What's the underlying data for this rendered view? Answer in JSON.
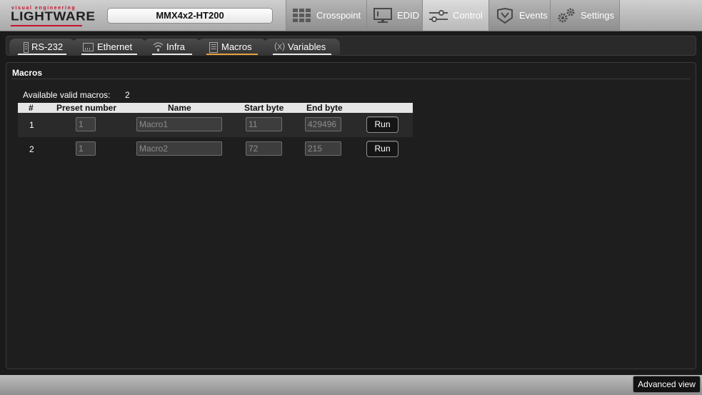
{
  "brand": {
    "tagline": "visual engineering",
    "name": "LIGHTWARE",
    "accent": "#c8102e"
  },
  "device": {
    "name": "MMX4x2-HT200"
  },
  "nav": [
    {
      "label": "Crosspoint",
      "icon": "crosspoint-grid-icon"
    },
    {
      "label": "EDID",
      "icon": "monitor-icon"
    },
    {
      "label": "Control",
      "icon": "sliders-icon",
      "active": true
    },
    {
      "label": "Events",
      "icon": "events-icon"
    },
    {
      "label": "Settings",
      "icon": "gears-icon"
    }
  ],
  "subtabs": [
    {
      "label": "RS-232",
      "icon": "serial-port-icon"
    },
    {
      "label": "Ethernet",
      "icon": "ethernet-icon"
    },
    {
      "label": "Infra",
      "icon": "infrared-icon"
    },
    {
      "label": "Macros",
      "icon": "macro-document-icon",
      "active": true
    },
    {
      "label": "Variables",
      "icon": "variable-x-icon",
      "icon_text": "(x)"
    }
  ],
  "panel": {
    "title": "Macros",
    "available_label": "Available valid macros:",
    "available_count": "2"
  },
  "table": {
    "columns": [
      "#",
      "Preset number",
      "Name",
      "Start byte",
      "End byte"
    ],
    "rows": [
      {
        "num": "1",
        "preset": "1",
        "name": "Macro1",
        "start": "11",
        "end": "429496",
        "action": "Run"
      },
      {
        "num": "2",
        "preset": "1",
        "name": "Macro2",
        "start": "72",
        "end": "215",
        "action": "Run"
      }
    ]
  },
  "footer": {
    "advanced_label": "Advanced view"
  }
}
